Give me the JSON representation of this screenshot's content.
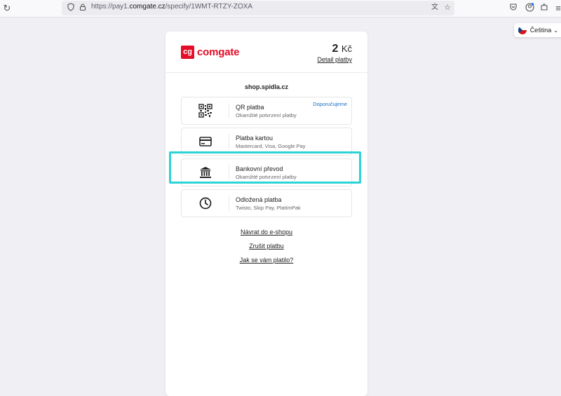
{
  "browser": {
    "url_prefix": "https://pay1.",
    "url_domain": "comgate.cz",
    "url_path": "/specify/1WMT-RTZY-ZOXA"
  },
  "language": {
    "label": "Čeština"
  },
  "header": {
    "logo_mark": "cg",
    "logo_text": "comgate",
    "amount": "2",
    "currency": "Kč",
    "detail_link": "Detail platby"
  },
  "shop": {
    "name": "shop.spidla.cz"
  },
  "methods": [
    {
      "title": "QR platba",
      "subtitle": "Okamžité potvrzení platby",
      "badge": "Doporučujeme",
      "icon": "qr-code-icon"
    },
    {
      "title": "Platba kartou",
      "subtitle": "Mastercard, Visa, Google Pay",
      "icon": "credit-card-icon"
    },
    {
      "title": "Bankovní převod",
      "subtitle": "Okamžité potvrzení platby",
      "icon": "bank-icon"
    },
    {
      "title": "Odložená platba",
      "subtitle": "Twisto, Skip Pay, PlatímPak",
      "icon": "clock-icon"
    }
  ],
  "links": {
    "return": "Návrat do e-shopu",
    "cancel": "Zrušit platbu",
    "feedback": "Jak se vám platilo?"
  },
  "colors": {
    "brand": "#e30e27",
    "highlight": "#2ed3d8",
    "badge": "#1a6fc7"
  }
}
